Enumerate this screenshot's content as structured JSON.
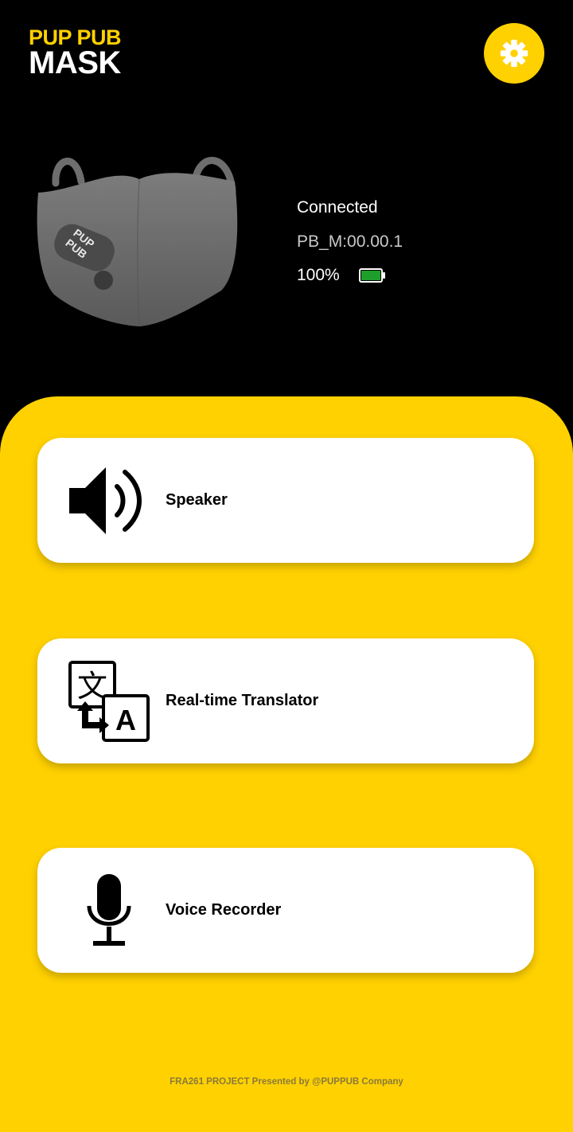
{
  "header": {
    "brand_top": "PUP PUB",
    "brand_bottom": "MASK",
    "settings_icon": "gear-icon"
  },
  "device": {
    "image": "face-mask-image",
    "connection_status": "Connected",
    "device_id": "PB_M:00.00.1",
    "battery_percent_text": "100%",
    "battery_level": 1.0,
    "logo_text": "PUP PUB"
  },
  "menu": [
    {
      "label": "Speaker",
      "icon": "speaker-icon"
    },
    {
      "label": "Real-time Translator",
      "icon": "translate-icon"
    },
    {
      "label": "Voice Recorder",
      "icon": "microphone-icon"
    }
  ],
  "footer": {
    "text": "FRA261 PROJECT Presented by @PUPPUB Company"
  },
  "colors": {
    "accent": "#FFD100",
    "background": "#000000",
    "card": "#FFFFFF",
    "battery": "#1E9E2A"
  }
}
